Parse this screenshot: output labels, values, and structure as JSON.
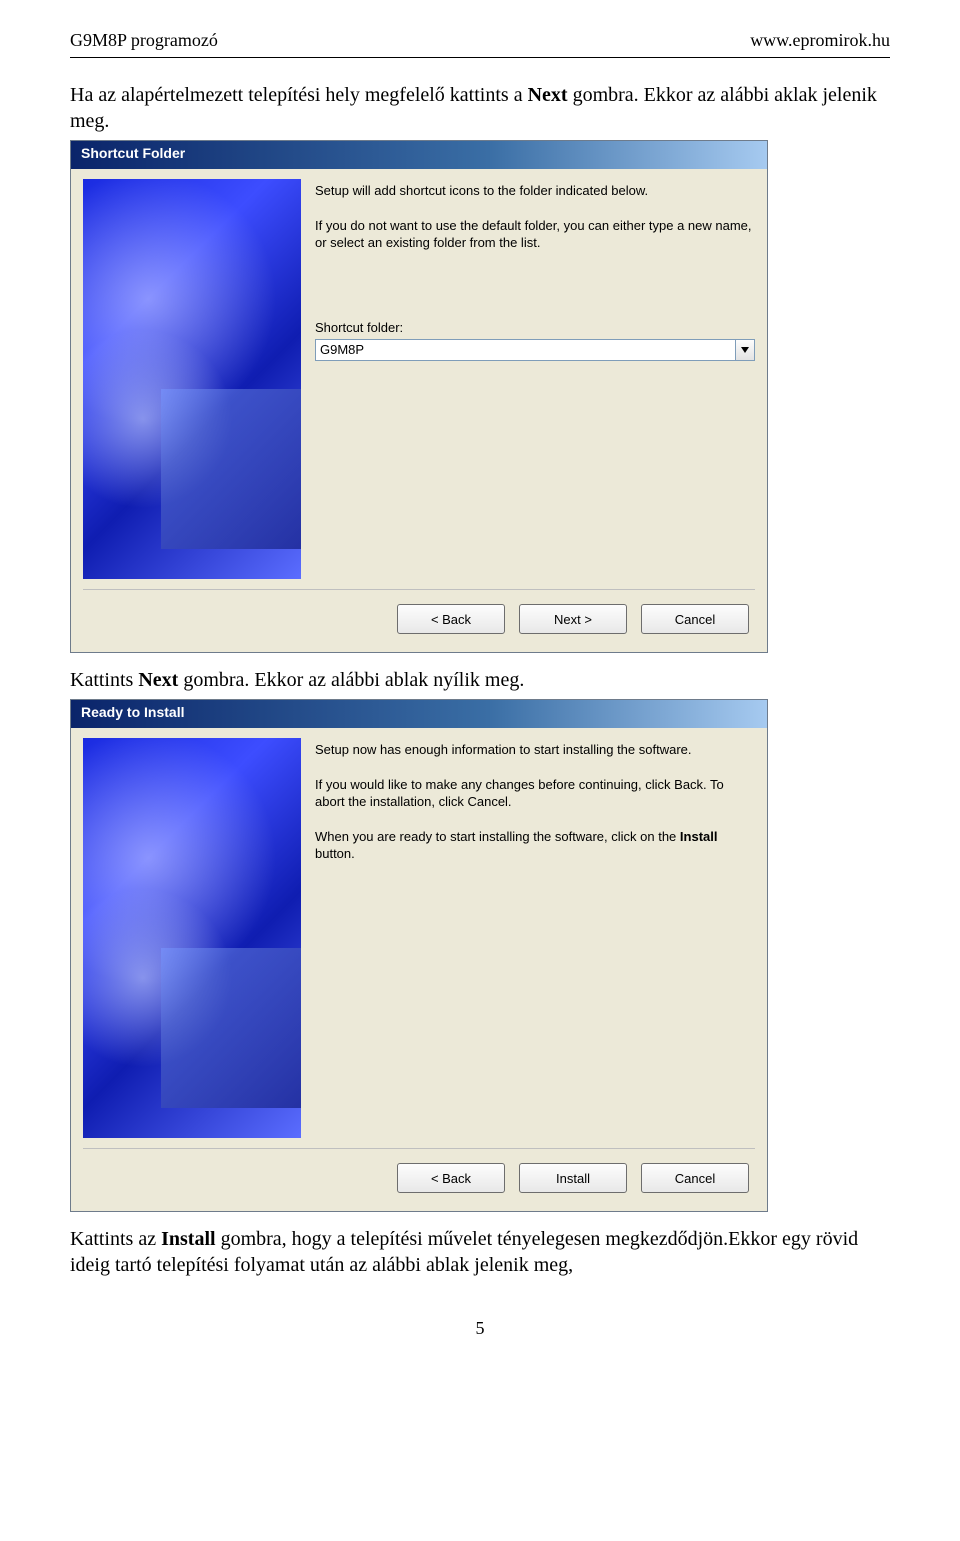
{
  "header": {
    "left": "G9M8P programozó",
    "right": "www.epromirok.hu"
  },
  "para1_pre": "Ha az alapértelmezett telepítési hely megfelelő kattints a ",
  "para1_bold": "Next",
  "para1_post": " gombra. Ekkor az alábbi aklak jelenik meg.",
  "dlg1": {
    "title": "Shortcut Folder",
    "text1": "Setup will add shortcut icons to the folder indicated below.",
    "text2": "If you do not want to use the default folder, you can either type a new name, or select an existing folder from the list.",
    "field_label": "Shortcut folder:",
    "field_value": "G9M8P",
    "buttons": {
      "back": "< Back",
      "next": "Next >",
      "cancel": "Cancel"
    }
  },
  "para2_pre": "Kattints ",
  "para2_bold": "Next",
  "para2_post": " gombra. Ekkor az alábbi ablak nyílik meg.",
  "dlg2": {
    "title": "Ready to Install",
    "text1": "Setup now has enough information to start installing the software.",
    "text2": "If you would like to make any changes before continuing, click Back.  To abort the installation, click Cancel.",
    "text3_pre": "When you are ready to start installing the software, click on the ",
    "text3_bold": "Install",
    "text3_post": " button.",
    "buttons": {
      "back": "< Back",
      "install": "Install",
      "cancel": "Cancel"
    }
  },
  "para3_pre": "Kattints az ",
  "para3_bold": "Install",
  "para3_post": " gombra, hogy a telepítési művelet tényelegesen megkezdődjön.Ekkor egy rövid ideig tartó telepítési folyamat után az alábbi ablak jelenik meg,",
  "page_number": "5"
}
